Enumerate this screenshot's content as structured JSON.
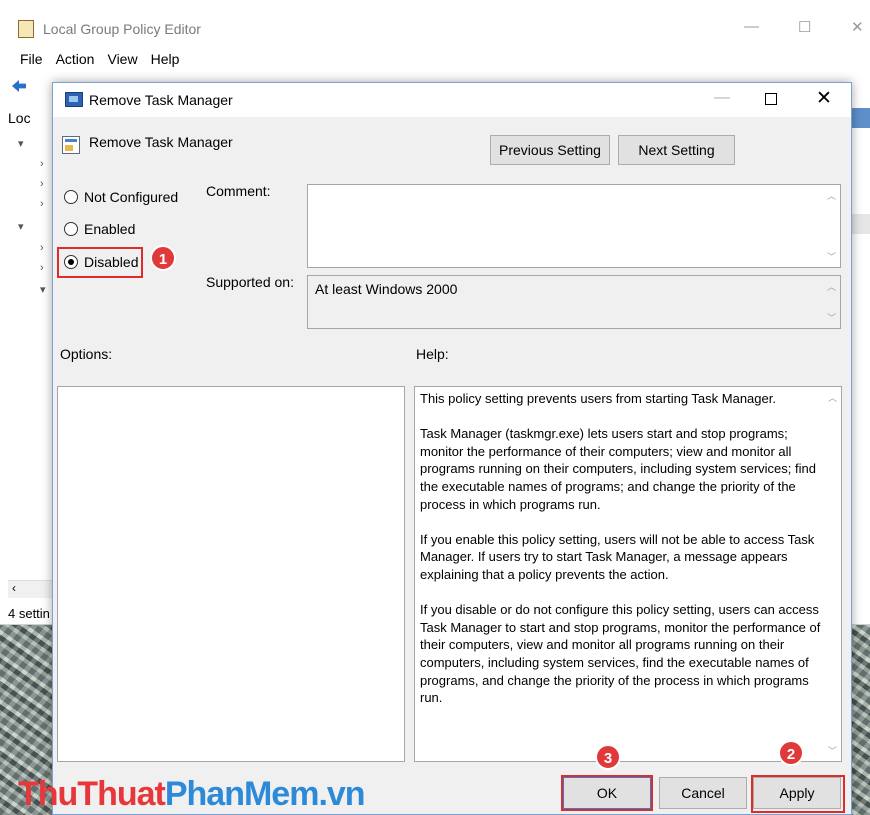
{
  "parent_window": {
    "title": "Local Group Policy Editor",
    "menu": [
      "File",
      "Action",
      "View",
      "Help"
    ],
    "tree_root_label": "Loc",
    "status_text": "4 settin",
    "minimize": "—",
    "maximize": "☐",
    "close": "✕"
  },
  "dialog": {
    "title": "Remove Task Manager",
    "setting_name": "Remove Task Manager",
    "previous_label": "Previous Setting",
    "next_label": "Next Setting",
    "state_options": [
      {
        "label": "Not Configured",
        "checked": false
      },
      {
        "label": "Enabled",
        "checked": false
      },
      {
        "label": "Disabled",
        "checked": true
      }
    ],
    "comment_label": "Comment:",
    "comment_value": "",
    "supported_label": "Supported on:",
    "supported_value": "At least Windows 2000",
    "options_label": "Options:",
    "help_label": "Help:",
    "help_paragraphs": [
      "This policy setting prevents users from starting Task Manager.",
      "Task Manager (taskmgr.exe) lets users start and stop programs; monitor the performance of their computers; view and monitor all programs running on their computers, including system services; find the executable names of programs; and change the priority of the process in which programs run.",
      "If you enable this policy setting, users will not be able to access Task Manager. If users try to start Task Manager, a message appears explaining that a policy prevents the action.",
      "If you disable or do not configure this policy setting, users can access Task Manager to  start and stop programs, monitor the performance of their computers, view and monitor all programs running on their computers, including system services, find the executable names of programs, and change the priority of the process in which programs run."
    ],
    "ok_label": "OK",
    "cancel_label": "Cancel",
    "apply_label": "Apply"
  },
  "annotations": {
    "badge_1": "1",
    "badge_2": "2",
    "badge_3": "3",
    "highlight_color": "#e02b2b"
  },
  "watermark": {
    "part_1": "ThuThuat",
    "part_2": "PhanMem",
    "part_3": ".vn"
  }
}
